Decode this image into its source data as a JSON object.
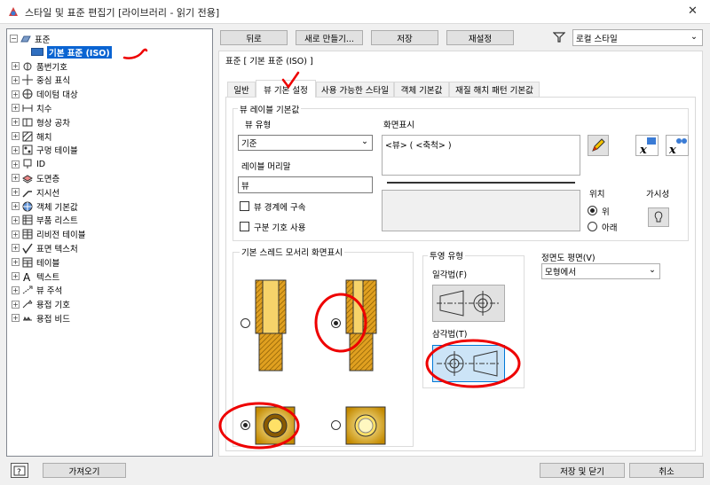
{
  "window": {
    "title": "스타일 및 표준 편집기 [라이브러리 - 읽기 전용]",
    "close_glyph": "✕"
  },
  "toolbar": {
    "back": "뒤로",
    "new": "새로 만들기...",
    "save": "저장",
    "reset": "재설정",
    "filter_value": "로컬 스타일"
  },
  "tree": {
    "root": "표준",
    "selected": "기본 표준 (ISO)",
    "items": [
      "품번기호",
      "중심 표식",
      "데이텀 대상",
      "치수",
      "형상 공차",
      "해치",
      "구멍 테이블",
      "ID",
      "도면층",
      "지시선",
      "객체 기본값",
      "부품 리스트",
      "리비전 테이블",
      "표면 텍스처",
      "테이블",
      "텍스트",
      "뷰 주석",
      "용접 기호",
      "용접 비드"
    ]
  },
  "header": "표준 [ 기본 표준 (ISO) ]",
  "tabs": [
    "일반",
    "뷰 기본 설정",
    "사용 가능한 스타일",
    "객체 기본값",
    "재질 해치 패턴 기본값"
  ],
  "view_label": {
    "group": "뷰 레이블 기본값",
    "view_type_label": "뷰 유형",
    "view_type_value": "기준",
    "prefix_label": "레이블 머리말",
    "prefix_value": "뷰",
    "constrain_label": "뷰 경계에 구속",
    "symbol_label": "구분 기호 사용",
    "display_label": "화면표시",
    "display_value": "<뷰> ( <축척> )",
    "position_label": "위치",
    "pos_above": "위",
    "pos_below": "아래",
    "visibility_label": "가시성"
  },
  "thread": {
    "group": "기본 스레드 모서리 화면표시"
  },
  "projection": {
    "group": "투영 유형",
    "first": "일각법(F)",
    "third": "삼각법(T)"
  },
  "front_plane": {
    "label": "정면도 평면(V)",
    "value": "모형에서"
  },
  "footer": {
    "import": "가져오기",
    "save_close": "저장 및 닫기",
    "cancel": "취소"
  }
}
